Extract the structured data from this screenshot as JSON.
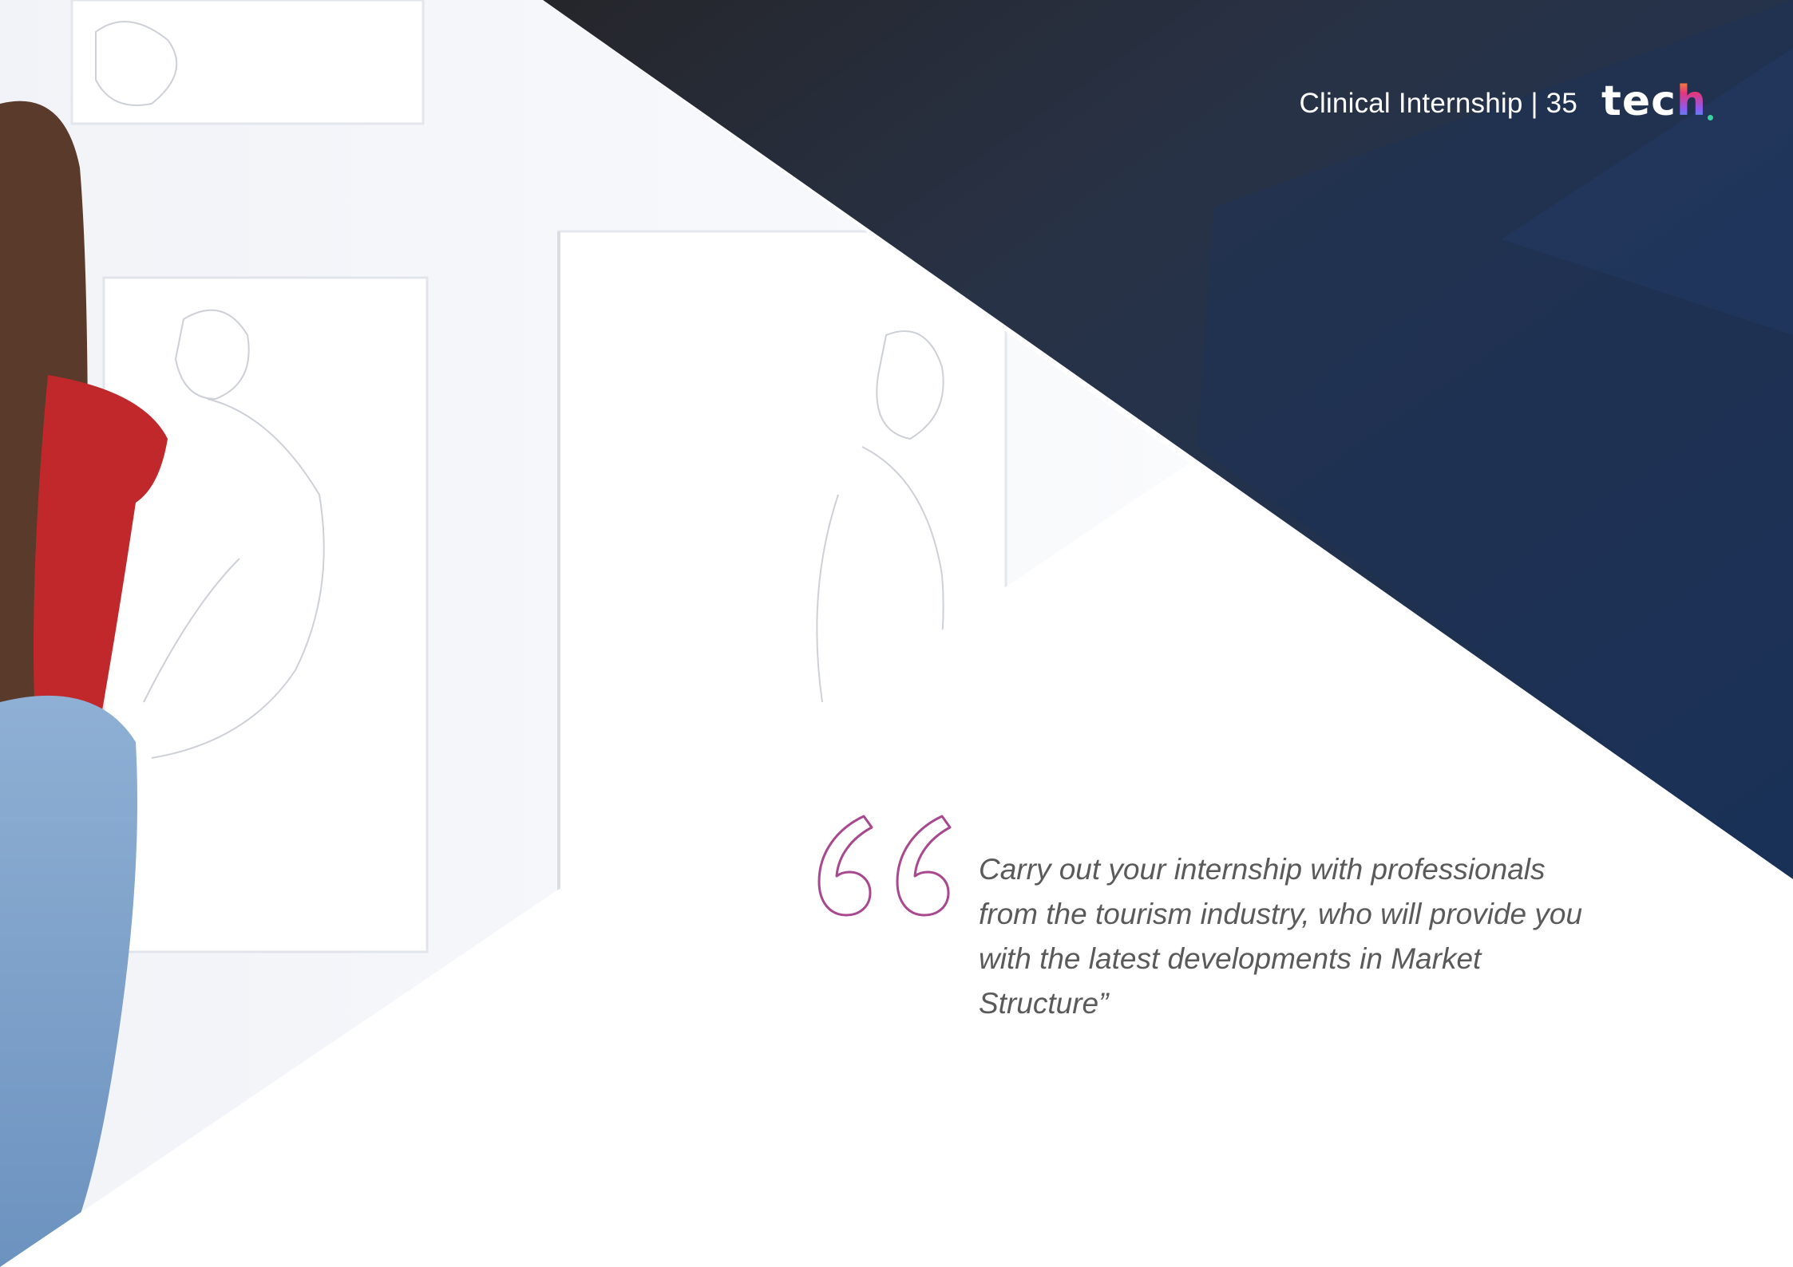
{
  "header": {
    "text": "Clinical Internship | 35",
    "logo_main": "tec",
    "logo_accent": "h",
    "logo_icon": "tech-logo"
  },
  "quote": {
    "icon": "open-quote-icon",
    "text": "Carry out your internship with professionals from the tourism industry, who will provide you with the latest developments in Market Structure”",
    "accent_color": "#a8488e"
  },
  "colors": {
    "dark_navy": "#1b2f52",
    "dark_charcoal": "#25262b",
    "photo_wall": "#f3f5fa"
  }
}
